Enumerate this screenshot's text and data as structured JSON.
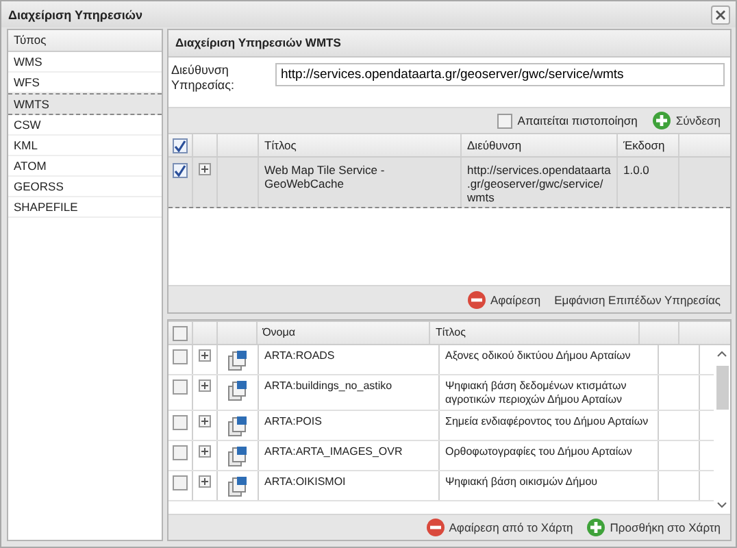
{
  "window": {
    "title": "Διαχείριση Υπηρεσιών"
  },
  "types": {
    "header": "Τύπος",
    "items": [
      {
        "label": "WMS",
        "selected": false
      },
      {
        "label": "WFS",
        "selected": false
      },
      {
        "label": "WMTS",
        "selected": true
      },
      {
        "label": "CSW",
        "selected": false
      },
      {
        "label": "KML",
        "selected": false
      },
      {
        "label": "ATOM",
        "selected": false
      },
      {
        "label": "GEORSS",
        "selected": false
      },
      {
        "label": "SHAPEFILE",
        "selected": false
      }
    ]
  },
  "panel": {
    "title": "Διαχείριση Υπηρεσιών WMTS",
    "url_label": "Διεύθυνση Υπηρεσίας:",
    "url_value": "http://services.opendataarta.gr/geoserver/gwc/service/wmts",
    "auth": {
      "label": "Απαιτείται πιστοποίηση",
      "checked": false
    },
    "connect": "Σύνδεση"
  },
  "services": {
    "header_checked": true,
    "columns": [
      "Τίτλος",
      "Διεύθυνση",
      "Έκδοση"
    ],
    "rows": [
      {
        "checked": true,
        "selected": true,
        "title": "Web Map Tile Service - GeoWebCache",
        "address": "http://services.opendataarta.gr/geoserver/gwc/service/wmts",
        "version": "1.0.0"
      }
    ],
    "remove": "Αφαίρεση",
    "show_layers": "Εμφάνιση Επιπέδων Υπηρεσίας"
  },
  "layers": {
    "header_checked": false,
    "columns": [
      "Όνομα",
      "Τίτλος"
    ],
    "rows": [
      {
        "checked": false,
        "name": "ARTA:ROADS",
        "title": "Αξονες οδικού δικτύου Δήμου Αρταίων"
      },
      {
        "checked": false,
        "name": "ARTA:buildings_no_astiko",
        "title": "Ψηφιακή βάση δεδομένων κτισμάτων αγροτικών περιοχών Δήμου Αρταίων"
      },
      {
        "checked": false,
        "name": "ARTA:POIS",
        "title": "Σημεία ενδιαφέροντος του Δήμου Αρταίων"
      },
      {
        "checked": false,
        "name": "ARTA:ARTA_IMAGES_OVR",
        "title": "Ορθοφωτογραφίες του Δήμου Αρταίων"
      },
      {
        "checked": false,
        "name": "ARTA:OIKISMOI",
        "title": "Ψηφιακή βάση οικισμών Δήμου"
      }
    ],
    "remove_map": "Αφαίρεση από το Χάρτη",
    "add_map": "Προσθήκη στο Χάρτη"
  }
}
